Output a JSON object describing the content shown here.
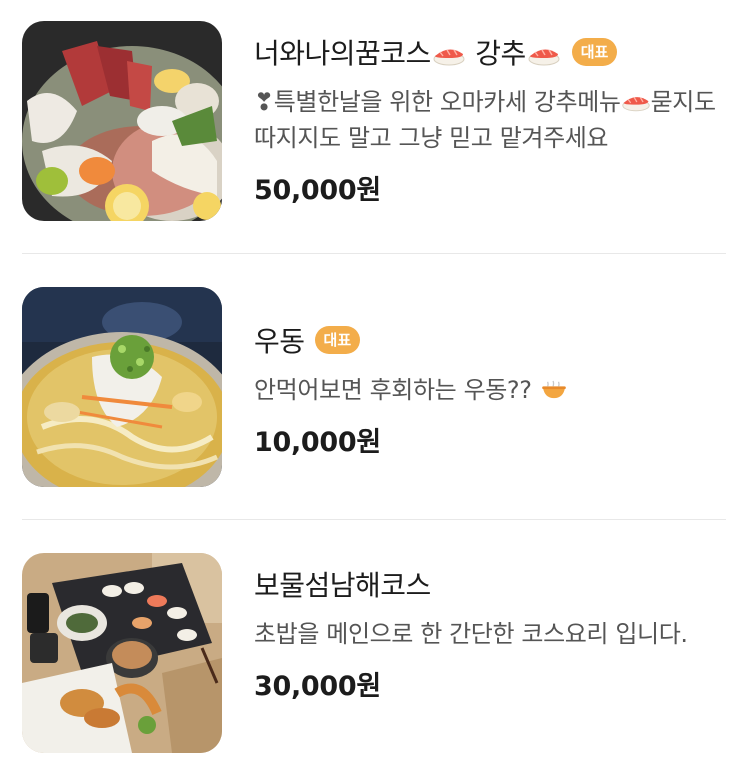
{
  "menu": {
    "items": [
      {
        "title_part1": "너와나의꿈코스",
        "title_part2": " 강추",
        "badge": "대표",
        "desc_prefix": "❣특별한날을 위한 오마카세 강추메뉴",
        "desc_suffix": "묻지도 따지지도 말고 그냥 믿고 맡겨주세요",
        "price": "50,000원",
        "icons": [
          "sushi-emoji-icon"
        ]
      },
      {
        "title": "우동",
        "badge": "대표",
        "desc_text": "안먹어보면 후회하는 우동??",
        "price": "10,000원",
        "icons": [
          "noodle-bowl-emoji-icon"
        ]
      },
      {
        "title": "보물섬남해코스",
        "desc": "초밥을 메인으로 한 간단한 코스요리 입니다.",
        "price": "30,000원"
      }
    ]
  },
  "colors": {
    "badge": "#f3ad4a",
    "title": "#1c1c1c",
    "description": "#555555",
    "divider": "#e8e8e8"
  }
}
